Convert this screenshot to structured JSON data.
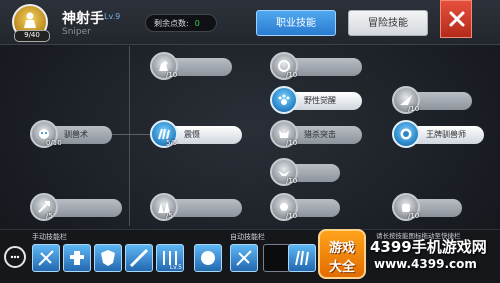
{
  "header": {
    "class_name": "神射手",
    "class_level": "Lv.9",
    "class_name_en": "Sniper",
    "avatar_level": "9/40",
    "points_label": "剩余点数:",
    "points_value": "0",
    "tabs": [
      {
        "label": "职业技能",
        "active": true
      },
      {
        "label": "冒险技能",
        "active": false
      }
    ],
    "close_icon": "close-x-icon"
  },
  "skills": [
    {
      "name": "",
      "level": "/10",
      "lit": false,
      "icon": "horse-icon"
    },
    {
      "name": "驯兽术",
      "level": "0/10",
      "lit": true,
      "icon": "beast-icon"
    },
    {
      "name": "震慑",
      "level": "5/5",
      "lit": true,
      "icon": "claw-icon"
    },
    {
      "name": "",
      "level": "/5",
      "lit": false,
      "icon": "arrow-icon"
    },
    {
      "name": "",
      "level": "/5",
      "lit": false,
      "icon": "spike-icon"
    },
    {
      "name": "",
      "level": "/10",
      "lit": false,
      "icon": "ring-icon"
    },
    {
      "name": "野性觉醒",
      "level": "",
      "lit": true,
      "icon": "paw-icon"
    },
    {
      "name": "猎杀突击",
      "level": "/10",
      "lit": false,
      "icon": "wolf-icon"
    },
    {
      "name": "",
      "level": "/10",
      "lit": false,
      "icon": "eagle-icon"
    },
    {
      "name": "",
      "level": "/10",
      "lit": false,
      "icon": "bird-icon"
    },
    {
      "name": "",
      "level": "/10",
      "lit": false,
      "icon": "wing-icon"
    },
    {
      "name": "王牌驯兽师",
      "level": "",
      "lit": true,
      "icon": "lion-icon"
    },
    {
      "name": "",
      "level": "/10",
      "lit": false,
      "icon": "fist-icon"
    }
  ],
  "bottom": {
    "manual_label": "手动技能栏",
    "auto_label": "自动技能栏",
    "hint": "请长按技能图标拖动至快捷栏",
    "manual_slots": [
      {
        "icon": "crossbow-icon",
        "level": ""
      },
      {
        "icon": "totem-icon",
        "level": ""
      },
      {
        "icon": "shield-icon",
        "level": ""
      },
      {
        "icon": "shot-icon",
        "level": ""
      },
      {
        "icon": "arrow-rain-icon",
        "level": "Lv.5"
      },
      {
        "icon": "beast-icon",
        "level": ""
      },
      {
        "icon": "claw-icon",
        "level": ""
      }
    ],
    "auto_slots": [
      {
        "icon": "crossbow-icon",
        "level": ""
      },
      {
        "icon": "",
        "level": ""
      }
    ]
  },
  "watermark": {
    "badge_top": "游戏",
    "badge_bottom": "大全",
    "site_name": "4399手机游戏网",
    "url": "www.4399.com"
  },
  "colors": {
    "accent_blue": "#2a7bd0",
    "close_red": "#d2402c",
    "points_green": "#39d34a"
  }
}
